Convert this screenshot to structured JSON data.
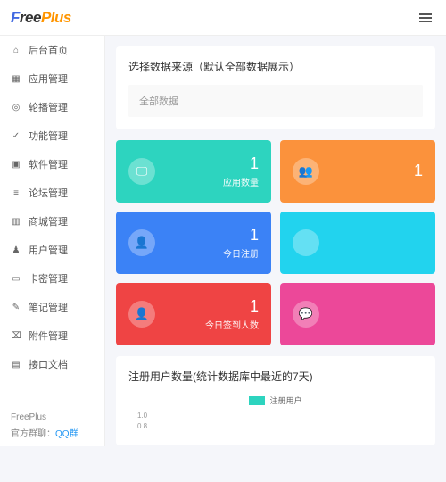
{
  "logo": "FreePlus",
  "sidebar": {
    "items": [
      {
        "icon": "⌂",
        "label": "后台首页"
      },
      {
        "icon": "▦",
        "label": "应用管理"
      },
      {
        "icon": "◎",
        "label": "轮播管理"
      },
      {
        "icon": "✓",
        "label": "功能管理"
      },
      {
        "icon": "▣",
        "label": "软件管理"
      },
      {
        "icon": "≡",
        "label": "论坛管理"
      },
      {
        "icon": "▥",
        "label": "商城管理"
      },
      {
        "icon": "♟",
        "label": "用户管理"
      },
      {
        "icon": "▭",
        "label": "卡密管理"
      },
      {
        "icon": "✎",
        "label": "笔记管理"
      },
      {
        "icon": "⌧",
        "label": "附件管理"
      },
      {
        "icon": "▤",
        "label": "接口文档"
      }
    ]
  },
  "footer": {
    "name": "FreePlus",
    "contact_label": "官方群聊：",
    "qq": "QQ群"
  },
  "source_panel": {
    "title": "选择数据来源（默认全部数据展示）",
    "select_text": "全部数据"
  },
  "cards": [
    {
      "color": "#2dd4bf",
      "icon": "🖵",
      "value": "1",
      "label": "应用数量"
    },
    {
      "color": "#fb923c",
      "icon": "👥",
      "value": "1",
      "label": ""
    },
    {
      "color": "#3b82f6",
      "icon": "👤",
      "value": "1",
      "label": "今日注册"
    },
    {
      "color": "#22d3ee",
      "icon": "",
      "value": "",
      "label": ""
    },
    {
      "color": "#ef4444",
      "icon": "👤",
      "value": "1",
      "label": "今日签到人数"
    },
    {
      "color": "#ec4899",
      "icon": "💬",
      "value": "",
      "label": ""
    }
  ],
  "chart": {
    "title": "注册用户数量(统计数据库中最近的7天)",
    "legend": "注册用户"
  },
  "chart_data": {
    "type": "line",
    "title": "注册用户数量(统计数据库中最近的7天)",
    "series": [
      {
        "name": "注册用户",
        "values": []
      }
    ],
    "ylim": [
      0,
      1
    ],
    "yticks": [
      1.0,
      0.8
    ]
  }
}
